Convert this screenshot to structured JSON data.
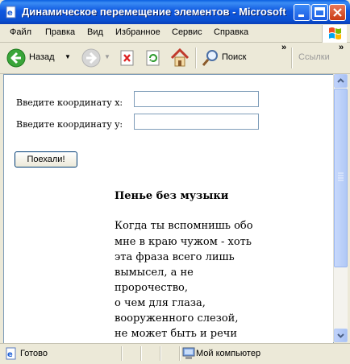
{
  "window": {
    "title": "Динамическое перемещение элементов - Microsoft Internet Explorer"
  },
  "menu": [
    "Файл",
    "Правка",
    "Вид",
    "Избранное",
    "Сервис",
    "Справка"
  ],
  "toolbar": {
    "back_label": "Назад",
    "search_label": "Поиск",
    "links_label": "Ссылки",
    "chevron": "»"
  },
  "form": {
    "x_label": "Введите координату x:",
    "y_label": "Введите координату y:",
    "x_value": "",
    "y_value": "",
    "go_button": "Поехали!"
  },
  "poem": {
    "title": "Пенье без музыки",
    "lines": [
      "Когда ты вспомнишь обо",
      "мне в краю чужом - хоть",
      "эта фраза всего лишь",
      "вымысел, а не",
      "пророчество,",
      "о чем для глаза,",
      "вооруженного слезой,",
      "не может быть и речи"
    ]
  },
  "status": {
    "left": "Готово",
    "zone": "Мой компьютер"
  },
  "colors": {
    "titlebar": "#0a58e0",
    "close_button": "#c93b14"
  }
}
